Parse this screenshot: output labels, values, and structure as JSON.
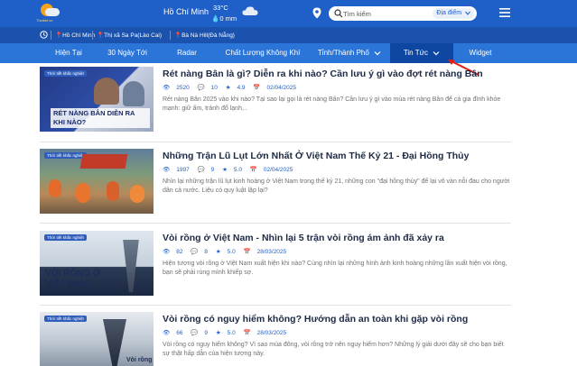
{
  "header": {
    "logo_text": "Thoitiet.vn",
    "city": "Hồ Chí Minh",
    "temperature": "33°C",
    "rain": "0 mm",
    "search_placeholder": "Tìm kiếm",
    "location_label": "Địa điểm"
  },
  "locations": [
    "Hồ Chí Minh",
    "Thị xã Sa Pa(Lào Cai)",
    "Bà Nà Hill(Đà Nẵng)"
  ],
  "nav": [
    {
      "label": "Hiện Tại"
    },
    {
      "label": "30 Ngày Tới"
    },
    {
      "label": "Radar"
    },
    {
      "label": "Chất Lượng Không Khí"
    },
    {
      "label": "Tỉnh/Thành Phố"
    },
    {
      "label": "Tin Tức"
    },
    {
      "label": "Widget"
    }
  ],
  "articles": [
    {
      "badge": "Thời tiết khắc nghiệt",
      "thumb_caption": "RÉT NÀNG BÂN DIỄN RA KHI NÀO?",
      "title": "Rét nàng Bân là gì? Diễn ra khi nào? Cần lưu ý gì vào đợt rét nàng Bân",
      "views": "2520",
      "comments": "10",
      "rating": "4.9",
      "date": "02/04/2025",
      "desc": "Rét nàng Bân 2025 vào khi nào? Tại sao lại gọi là rét nàng Bân? Cần lưu ý gì vào mùa rét nàng Bân để cả gia đình khỏe mạnh: giữ ấm, tránh đổ lạnh,.."
    },
    {
      "badge": "Thời tiết khắc nghiệt",
      "thumb_caption": "",
      "title": "Những Trận Lũ Lụt Lớn Nhất Ở Việt Nam Thế Kỷ 21 - Đại Hồng Thủy",
      "views": "1997",
      "comments": "9",
      "rating": "5.0",
      "date": "02/04/2025",
      "desc": "Nhìn lại những trận lũ lụt kinh hoàng ở Việt Nam trong thế kỷ 21, những con \"đại hồng thủy\" để lại vô vàn nỗi đau cho người dân cả nước. Liệu có quy luật lặp lại?"
    },
    {
      "badge": "Thời tiết khắc nghiệt",
      "thumb_caption": "VÒI RỒNG Ở VIỆT NAM",
      "title": "Vòi rồng ở Việt Nam - Nhìn lại 5 trận vòi rồng ám ảnh đã xảy ra",
      "views": "82",
      "comments": "8",
      "rating": "5.0",
      "date": "28/03/2025",
      "desc": "Hiện tượng vòi rồng ở Việt Nam xuất hiện khi nào? Cùng nhìn lại những hình ảnh kinh hoàng những lần xuất hiện vòi rồng, bạn sẽ phải rùng mình khiếp sợ."
    },
    {
      "badge": "Thời tiết khắc nghiệt",
      "thumb_caption": "Vòi rồng",
      "title": "Vòi rồng có nguy hiểm không? Hướng dẫn an toàn khi gặp vòi rồng",
      "views": "66",
      "comments": "9",
      "rating": "5.0",
      "date": "28/03/2025",
      "desc": "Vòi rồng có nguy hiểm không? Vì sao mùa đông, vòi rồng trở nên nguy hiểm hơn? Những lý giải dưới đây sẽ cho bạn biết sự thật hấp dẫn của hiện tượng này."
    }
  ]
}
